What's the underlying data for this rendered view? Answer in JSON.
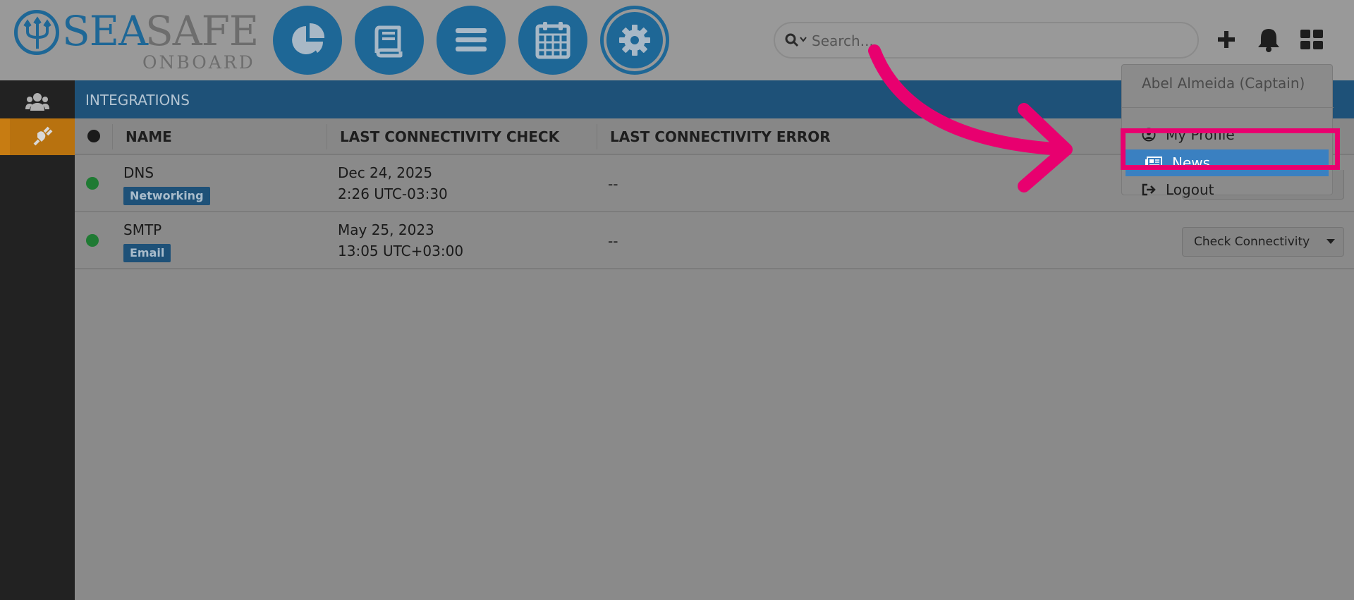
{
  "logo": {
    "sea": "SEA",
    "safe": "SAFE",
    "onboard": "ONBOARD"
  },
  "nav": {
    "items": [
      {
        "icon": "pie-chart-icon"
      },
      {
        "icon": "book-icon"
      },
      {
        "icon": "list-icon"
      },
      {
        "icon": "calendar-icon"
      },
      {
        "icon": "gear-icon"
      }
    ]
  },
  "search": {
    "placeholder": "Search...",
    "value": ""
  },
  "toolbar": {
    "icons": [
      "plus-icon",
      "bell-icon",
      "apps-grid-icon"
    ]
  },
  "sidebar": {
    "items": [
      {
        "icon": "users-icon"
      },
      {
        "icon": "plug-icon",
        "active": true
      }
    ]
  },
  "panel": {
    "title": "INTEGRATIONS",
    "columns": {
      "name": "NAME",
      "last_check": "LAST CONNECTIVITY CHECK",
      "last_error": "LAST CONNECTIVITY ERROR"
    }
  },
  "rows": [
    {
      "name": "DNS",
      "tag": "Networking",
      "date": "Dec 24, 2025",
      "time": "2:26 UTC-03:30",
      "error": "--",
      "status_color": "#1f7a33"
    },
    {
      "name": "SMTP",
      "tag": "Email",
      "date": "May 25, 2023",
      "time": "13:05 UTC+03:00",
      "error": "--",
      "status_color": "#1f7a33",
      "action": "Check Connectivity"
    }
  ],
  "user_menu": {
    "user": "Abel Almeida (Captain)",
    "items": [
      {
        "label": "My Profile",
        "icon": "user-circle-icon"
      },
      {
        "label": "News",
        "icon": "newspaper-icon",
        "highlighted": true
      },
      {
        "label": "Logout",
        "icon": "logout-icon"
      }
    ]
  },
  "colors": {
    "brand": "#1e6796",
    "highlight": "#3a80c1",
    "annotation": "#e8006f",
    "active_sidebar": "#c77c12"
  }
}
